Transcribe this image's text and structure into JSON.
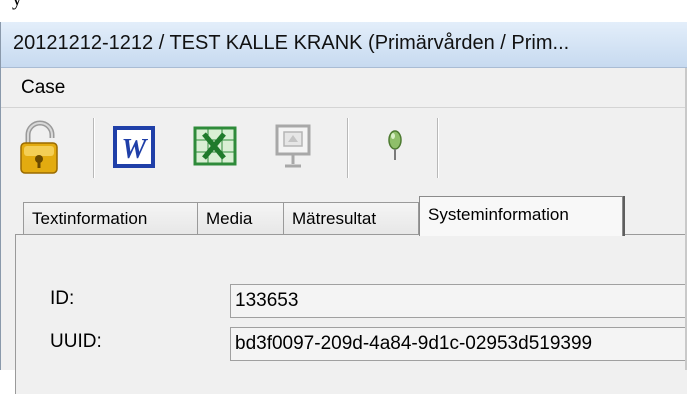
{
  "caption_fragment": "                                            y                                         ",
  "window": {
    "title": "20121212-1212 / TEST KALLE KRANK (Primärvården / Prim..."
  },
  "menu": {
    "items": [
      "Case"
    ]
  },
  "toolbar": {
    "buttons": [
      {
        "icon": "lock-icon"
      },
      {
        "icon": "word-icon"
      },
      {
        "icon": "excel-icon"
      },
      {
        "icon": "presentation-icon"
      },
      {
        "icon": "pin-icon"
      }
    ]
  },
  "tabs": [
    {
      "label": "Textinformation",
      "active": false
    },
    {
      "label": "Media",
      "active": false
    },
    {
      "label": "Mätresultat",
      "active": false
    },
    {
      "label": "Systeminformation",
      "active": true
    }
  ],
  "fields": {
    "id_label": "ID:",
    "id_value": "133653",
    "uuid_label": "UUID:",
    "uuid_value": "bd3f0097-209d-4a84-9d1c-02953d519399"
  },
  "colors": {
    "titlebar": "#c7daf0",
    "word_blue": "#1f3fa8",
    "excel_green": "#2e8b3a",
    "lock_gold": "#e0a800"
  }
}
